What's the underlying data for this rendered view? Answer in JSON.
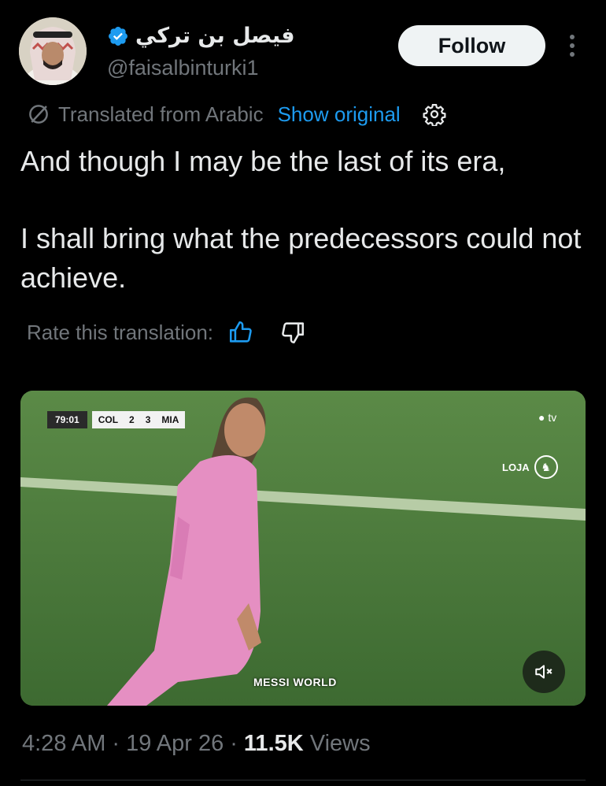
{
  "author": {
    "display_name": "فيصل بن تركي",
    "handle": "@faisalbinturki1",
    "verified": true
  },
  "follow_label": "Follow",
  "translation": {
    "translated_label": "Translated from Arabic",
    "show_original_label": "Show original",
    "rate_label": "Rate this translation:"
  },
  "tweet": {
    "line1": "And though I may be the last of its era,",
    "line2": "I shall bring what the predecessors could not achieve."
  },
  "media": {
    "scorebug": {
      "time": "79:01",
      "home": "COL",
      "home_score": "2",
      "away_score": "3",
      "away": "MIA"
    },
    "tv_logo": "tv",
    "channel_logo": "LOJA",
    "watermark": "MESSI WORLD"
  },
  "meta": {
    "time": "4:28 AM",
    "separator": "·",
    "date": "19 Apr 26",
    "views_count": "11.5K",
    "views_label": "Views"
  },
  "colors": {
    "background": "#000000",
    "text_primary": "#e7e9ea",
    "text_secondary": "#71767b",
    "link": "#1d9bf0",
    "verified": "#1d9bf0"
  },
  "icons": [
    "verified-badge-icon",
    "more-options-icon",
    "globe-slash-icon",
    "settings-gear-icon",
    "thumbs-up-icon",
    "thumbs-down-icon",
    "mute-icon"
  ]
}
